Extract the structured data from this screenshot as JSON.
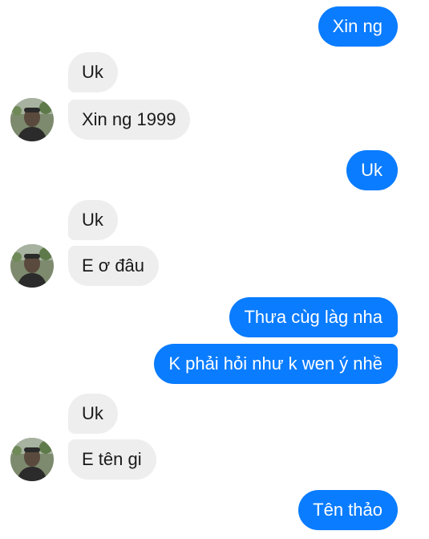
{
  "messages": [
    {
      "from": "me",
      "text": "Xin ng"
    },
    {
      "from": "them",
      "text": "Uk"
    },
    {
      "from": "them",
      "text": "Xin ng 1999"
    },
    {
      "from": "me",
      "text": "Uk"
    },
    {
      "from": "them",
      "text": "Uk"
    },
    {
      "from": "them",
      "text": "E ơ đâu"
    },
    {
      "from": "me",
      "text": "Thưa cùg làg nha"
    },
    {
      "from": "me",
      "text": "K phải hỏi như k wen ý nhề"
    },
    {
      "from": "them",
      "text": "Uk"
    },
    {
      "from": "them",
      "text": "E tên gi"
    },
    {
      "from": "me",
      "text": "Tên thảo"
    }
  ],
  "colors": {
    "outgoing_bubble": "#0a7cff",
    "incoming_bubble": "#eeeeef",
    "background": "#ffffff"
  },
  "icons": {
    "contact_avatar": "profile-photo"
  }
}
